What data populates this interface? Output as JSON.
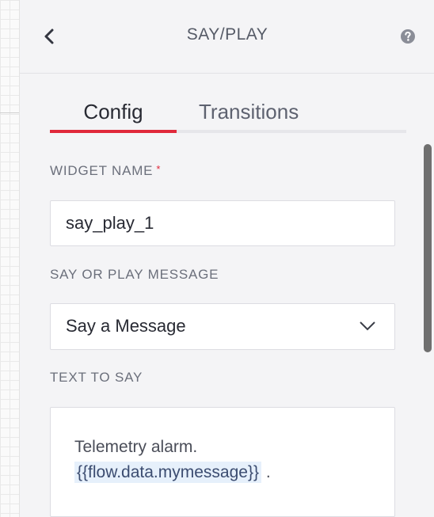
{
  "header": {
    "title": "SAY/PLAY"
  },
  "tabs": [
    {
      "label": "Config",
      "active": true
    },
    {
      "label": "Transitions",
      "active": false
    }
  ],
  "form": {
    "widget_name": {
      "label": "WIDGET NAME",
      "required_mark": "*",
      "value": "say_play_1"
    },
    "say_or_play": {
      "label": "SAY OR PLAY MESSAGE",
      "selected": "Say a Message"
    },
    "text_to_say": {
      "label": "TEXT TO SAY",
      "text_line1": "Telemetry alarm.",
      "variable": "{{flow.data.mymessage}}",
      "suffix": "."
    }
  },
  "icons": {
    "back": "chevron-left-icon",
    "help": "question-circle-icon",
    "dropdown": "chevron-down-icon"
  },
  "colors": {
    "accent": "#e0293b",
    "panel_bg": "#f4f4f6",
    "token_bg": "#e6f0fb"
  }
}
